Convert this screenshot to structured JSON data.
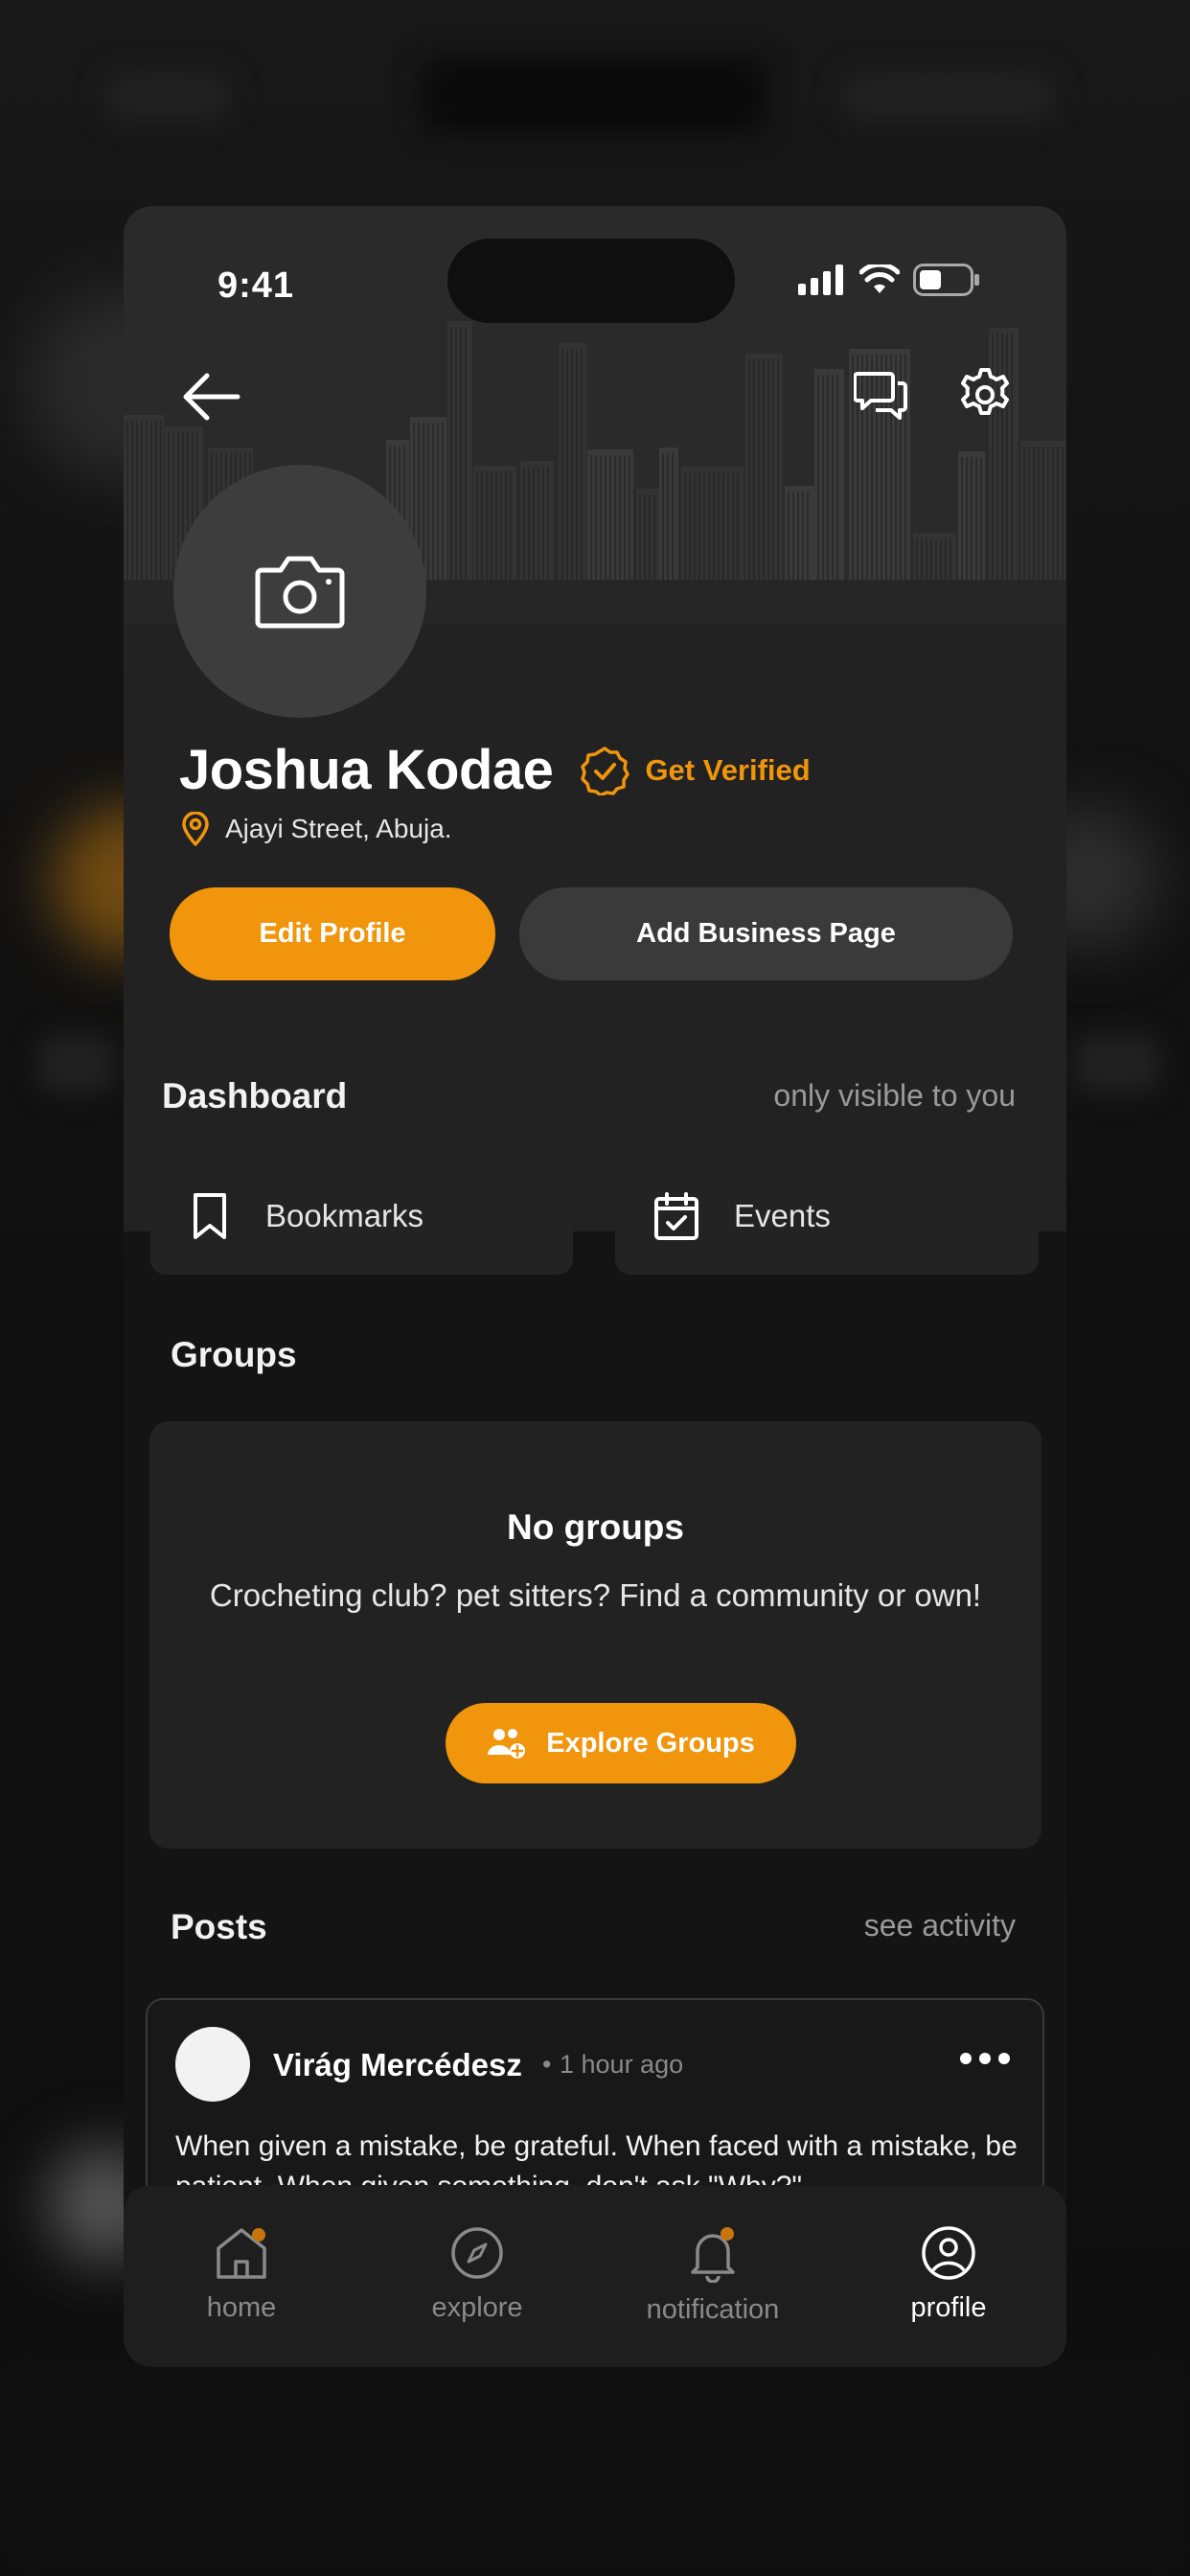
{
  "status_bar": {
    "time": "9:41"
  },
  "profile": {
    "name": "Joshua Kodae",
    "verify_label": "Get Verified",
    "location": "Ajayi Street, Abuja.",
    "edit_button": "Edit Profile",
    "business_button": "Add Business Page"
  },
  "dashboard": {
    "title": "Dashboard",
    "note": "only visible to you",
    "items": [
      {
        "label": "Bookmarks",
        "icon": "bookmark-icon"
      },
      {
        "label": "Events",
        "icon": "calendar-check-icon"
      }
    ]
  },
  "groups": {
    "title": "Groups",
    "empty_title": "No groups",
    "empty_text": "Crocheting club? pet sitters? Find a community or own!",
    "explore_button": "Explore Groups"
  },
  "posts": {
    "title": "Posts",
    "link": "see activity",
    "items": [
      {
        "author": "Virág Mercédesz",
        "time": "1 hour ago",
        "text": "When given a mistake, be grateful. When faced with a mistake, be patient. When given something, don't ask \"Why?\""
      }
    ]
  },
  "tabs": [
    {
      "label": "home",
      "icon": "home-icon",
      "active": false
    },
    {
      "label": "explore",
      "icon": "compass-icon",
      "active": false
    },
    {
      "label": "notification",
      "icon": "bell-icon",
      "active": false
    },
    {
      "label": "profile",
      "icon": "user-circle-icon",
      "active": true
    }
  ],
  "colors": {
    "accent": "#f0950c",
    "background": "#141414",
    "card": "#222222",
    "secondary_button": "#3a3a3a"
  }
}
